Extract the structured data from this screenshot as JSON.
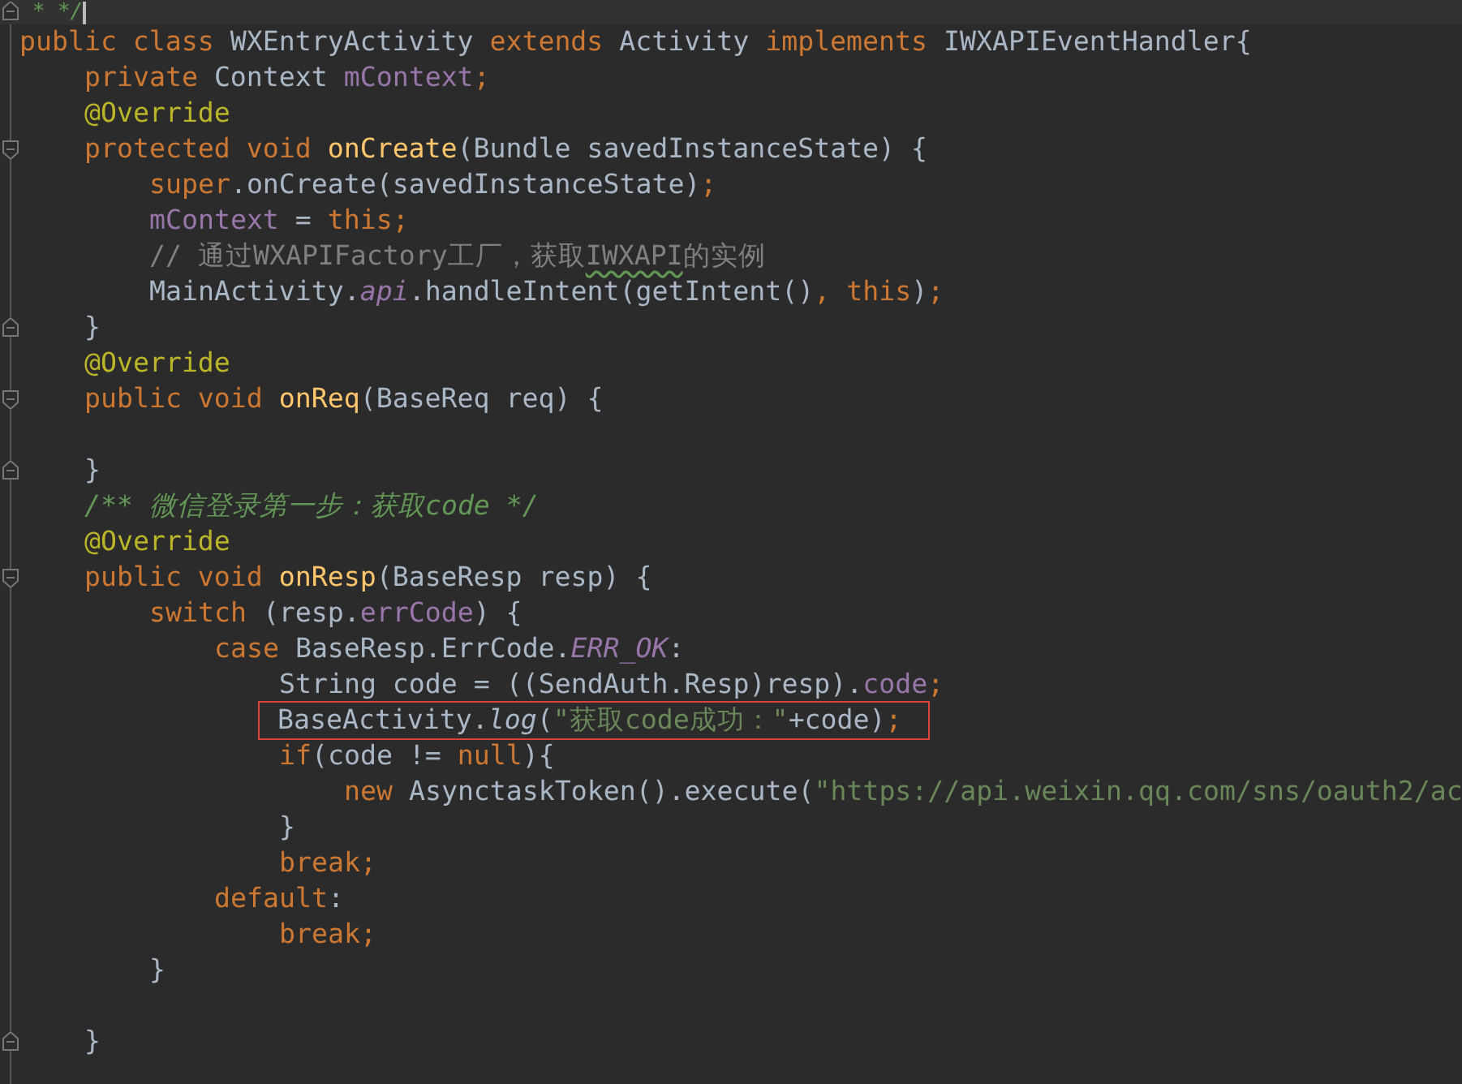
{
  "editor": {
    "lines": [
      {
        "kind": "code",
        "current": true,
        "fold_end": true,
        "tokens": [
          {
            "kind": "doc",
            "text": " * */"
          }
        ]
      },
      {
        "kind": "code",
        "tokens": [
          {
            "kind": "kw",
            "text": "public class "
          },
          {
            "kind": "plain",
            "text": "WXEntryActivity "
          },
          {
            "kind": "kw",
            "text": "extends "
          },
          {
            "kind": "plain",
            "text": "Activity "
          },
          {
            "kind": "kw",
            "text": "implements "
          },
          {
            "kind": "plain",
            "text": "IWXAPIEventHandler{"
          }
        ],
        "children": [
          {
            "kind": "code",
            "tokens": [
              {
                "kind": "kw",
                "text": "private "
              },
              {
                "kind": "plain",
                "text": "Context "
              },
              {
                "kind": "field",
                "text": "mContext"
              },
              {
                "kind": "kw",
                "text": ";"
              }
            ]
          },
          {
            "kind": "code",
            "tokens": [
              {
                "kind": "ann",
                "text": "@Override"
              }
            ]
          },
          {
            "kind": "code",
            "fold_start": true,
            "tokens": [
              {
                "kind": "kw",
                "text": "protected void "
              },
              {
                "kind": "fn",
                "text": "onCreate"
              },
              {
                "kind": "plain",
                "text": "(Bundle savedInstanceState) {"
              }
            ],
            "children": [
              {
                "kind": "code",
                "tokens": [
                  {
                    "kind": "kw",
                    "text": "super"
                  },
                  {
                    "kind": "plain",
                    "text": ".onCreate(savedInstanceState)"
                  },
                  {
                    "kind": "kw",
                    "text": ";"
                  }
                ]
              },
              {
                "kind": "code",
                "tokens": [
                  {
                    "kind": "field",
                    "text": "mContext"
                  },
                  {
                    "kind": "plain",
                    "text": " = "
                  },
                  {
                    "kind": "kw",
                    "text": "this;"
                  }
                ]
              },
              {
                "kind": "code",
                "tokens": [
                  {
                    "kind": "comment",
                    "text": "// 通过WXAPIFactory工厂，获取"
                  },
                  {
                    "kind": "typo",
                    "text": "IWXAPI"
                  },
                  {
                    "kind": "comment",
                    "text": "的实例"
                  }
                ]
              },
              {
                "kind": "code",
                "tokens": [
                  {
                    "kind": "plain",
                    "text": "MainActivity."
                  },
                  {
                    "kind": "static",
                    "text": "api"
                  },
                  {
                    "kind": "plain",
                    "text": ".handleIntent(getIntent()"
                  },
                  {
                    "kind": "kw",
                    "text": ", this"
                  },
                  {
                    "kind": "plain",
                    "text": ")"
                  },
                  {
                    "kind": "kw",
                    "text": ";"
                  }
                ]
              }
            ]
          },
          {
            "kind": "code",
            "fold_end": true,
            "tokens": [
              {
                "kind": "plain",
                "text": "}"
              }
            ]
          },
          {
            "kind": "code",
            "tokens": [
              {
                "kind": "ann",
                "text": "@Override"
              }
            ]
          },
          {
            "kind": "code",
            "fold_start": true,
            "tokens": [
              {
                "kind": "kw",
                "text": "public void "
              },
              {
                "kind": "fn",
                "text": "onReq"
              },
              {
                "kind": "plain",
                "text": "(BaseReq req) {"
              }
            ],
            "children": [
              {
                "kind": "blank"
              }
            ]
          },
          {
            "kind": "code",
            "fold_end": true,
            "tokens": [
              {
                "kind": "plain",
                "text": "}"
              }
            ]
          },
          {
            "kind": "code",
            "tokens": [
              {
                "kind": "doc",
                "text": "/** 微信登录第一步：获取code */"
              }
            ]
          },
          {
            "kind": "code",
            "tokens": [
              {
                "kind": "ann",
                "text": "@Override"
              }
            ]
          },
          {
            "kind": "code",
            "fold_start": true,
            "tokens": [
              {
                "kind": "kw",
                "text": "public void "
              },
              {
                "kind": "fn",
                "text": "onResp"
              },
              {
                "kind": "plain",
                "text": "(BaseResp resp) {"
              }
            ],
            "children": [
              {
                "kind": "code",
                "tokens": [
                  {
                    "kind": "kw",
                    "text": "switch "
                  },
                  {
                    "kind": "plain",
                    "text": "(resp."
                  },
                  {
                    "kind": "field",
                    "text": "errCode"
                  },
                  {
                    "kind": "plain",
                    "text": ") {"
                  }
                ],
                "children": [
                  {
                    "kind": "code",
                    "tokens": [
                      {
                        "kind": "kw",
                        "text": "case "
                      },
                      {
                        "kind": "plain",
                        "text": "BaseResp.ErrCode."
                      },
                      {
                        "kind": "static",
                        "text": "ERR_OK"
                      },
                      {
                        "kind": "plain",
                        "text": ":"
                      }
                    ],
                    "children": [
                      {
                        "kind": "code",
                        "tokens": [
                          {
                            "kind": "plain",
                            "text": "String code = ((SendAuth.Resp)resp)."
                          },
                          {
                            "kind": "field",
                            "text": "code"
                          },
                          {
                            "kind": "kw",
                            "text": ";"
                          }
                        ]
                      },
                      {
                        "kind": "code",
                        "highlighted": true,
                        "tokens": [
                          {
                            "kind": "plain",
                            "text": "BaseActivity."
                          },
                          {
                            "kind": "staticfn",
                            "text": "log"
                          },
                          {
                            "kind": "plain",
                            "text": "("
                          },
                          {
                            "kind": "str",
                            "text": "\"获取code成功：\""
                          },
                          {
                            "kind": "plain",
                            "text": "+code)"
                          },
                          {
                            "kind": "kw",
                            "text": ";"
                          }
                        ]
                      },
                      {
                        "kind": "code",
                        "tokens": [
                          {
                            "kind": "kw",
                            "text": "if"
                          },
                          {
                            "kind": "plain",
                            "text": "(code != "
                          },
                          {
                            "kind": "kw",
                            "text": "null"
                          },
                          {
                            "kind": "plain",
                            "text": "){"
                          }
                        ],
                        "children": [
                          {
                            "kind": "code",
                            "tokens": [
                              {
                                "kind": "kw",
                                "text": "new "
                              },
                              {
                                "kind": "plain",
                                "text": "AsynctaskToken().execute("
                              },
                              {
                                "kind": "str",
                                "text": "\"https://api.weixin.qq.com/sns/oauth2/ac"
                              }
                            ]
                          }
                        ]
                      },
                      {
                        "kind": "code",
                        "tokens": [
                          {
                            "kind": "plain",
                            "text": "}"
                          }
                        ]
                      },
                      {
                        "kind": "code",
                        "tokens": [
                          {
                            "kind": "kw",
                            "text": "break;"
                          }
                        ]
                      }
                    ]
                  },
                  {
                    "kind": "code",
                    "tokens": [
                      {
                        "kind": "kw",
                        "text": "default"
                      },
                      {
                        "kind": "plain",
                        "text": ":"
                      }
                    ],
                    "children": [
                      {
                        "kind": "code",
                        "tokens": [
                          {
                            "kind": "kw",
                            "text": "break;"
                          }
                        ]
                      }
                    ]
                  }
                ]
              },
              {
                "kind": "code",
                "tokens": [
                  {
                    "kind": "plain",
                    "text": "}"
                  }
                ]
              },
              {
                "kind": "blank"
              }
            ]
          },
          {
            "kind": "code",
            "fold_end": true,
            "tokens": [
              {
                "kind": "plain",
                "text": "}"
              }
            ]
          }
        ]
      }
    ]
  }
}
